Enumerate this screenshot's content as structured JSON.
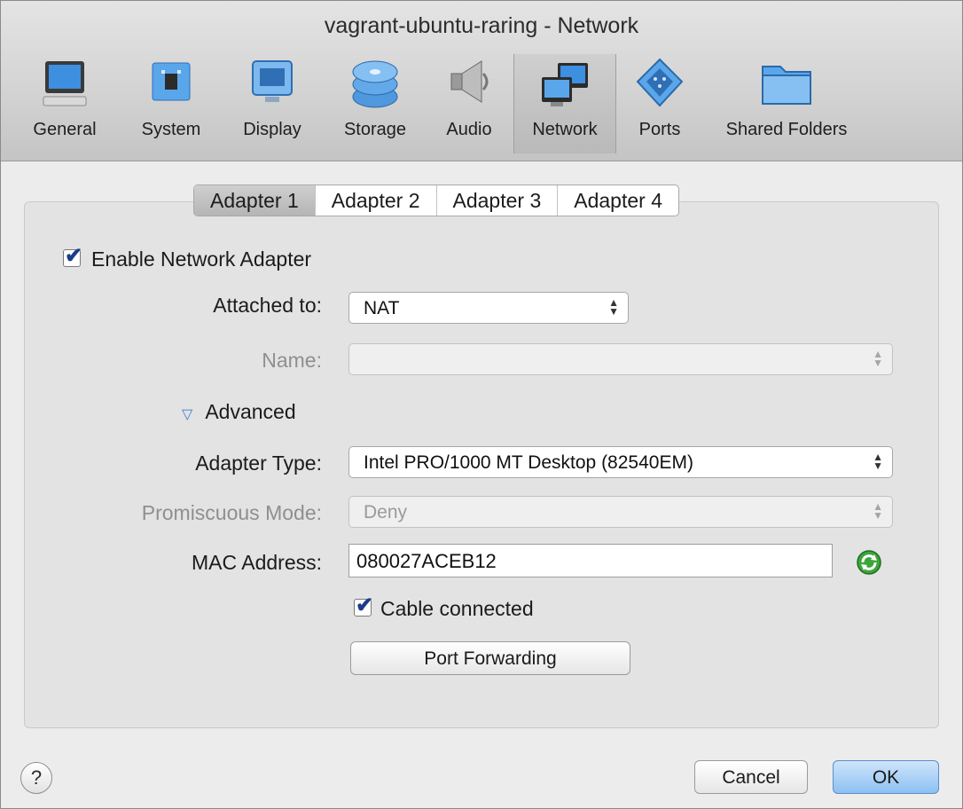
{
  "window": {
    "title": "vagrant-ubuntu-raring - Network"
  },
  "toolbar": {
    "items": [
      {
        "label": "General",
        "icon": "monitor-icon"
      },
      {
        "label": "System",
        "icon": "chip-icon"
      },
      {
        "label": "Display",
        "icon": "display-icon"
      },
      {
        "label": "Storage",
        "icon": "disks-icon"
      },
      {
        "label": "Audio",
        "icon": "speaker-icon"
      },
      {
        "label": "Network",
        "icon": "network-icon",
        "selected": true
      },
      {
        "label": "Ports",
        "icon": "serial-port-icon"
      },
      {
        "label": "Shared Folders",
        "icon": "folder-icon"
      }
    ]
  },
  "tabs": [
    {
      "label": "Adapter 1",
      "active": true
    },
    {
      "label": "Adapter 2"
    },
    {
      "label": "Adapter 3"
    },
    {
      "label": "Adapter 4"
    }
  ],
  "form": {
    "enable_adapter_label": "Enable Network Adapter",
    "attached_to_label": "Attached to:",
    "attached_to_value": "NAT",
    "name_label": "Name:",
    "name_value": "",
    "advanced_label": "Advanced",
    "adapter_type_label": "Adapter Type:",
    "adapter_type_value": "Intel PRO/1000 MT Desktop (82540EM)",
    "promiscuous_label": "Promiscuous Mode:",
    "promiscuous_value": "Deny",
    "mac_label": "MAC Address:",
    "mac_value": "080027ACEB12",
    "cable_label": "Cable connected",
    "port_forwarding_label": "Port Forwarding"
  },
  "footer": {
    "help_label": "?",
    "cancel_label": "Cancel",
    "ok_label": "OK"
  },
  "colors": {
    "ok_button": "#8cc1f2",
    "checkmark": "#1b3c8a",
    "refresh_icon": "#3aa63a"
  }
}
